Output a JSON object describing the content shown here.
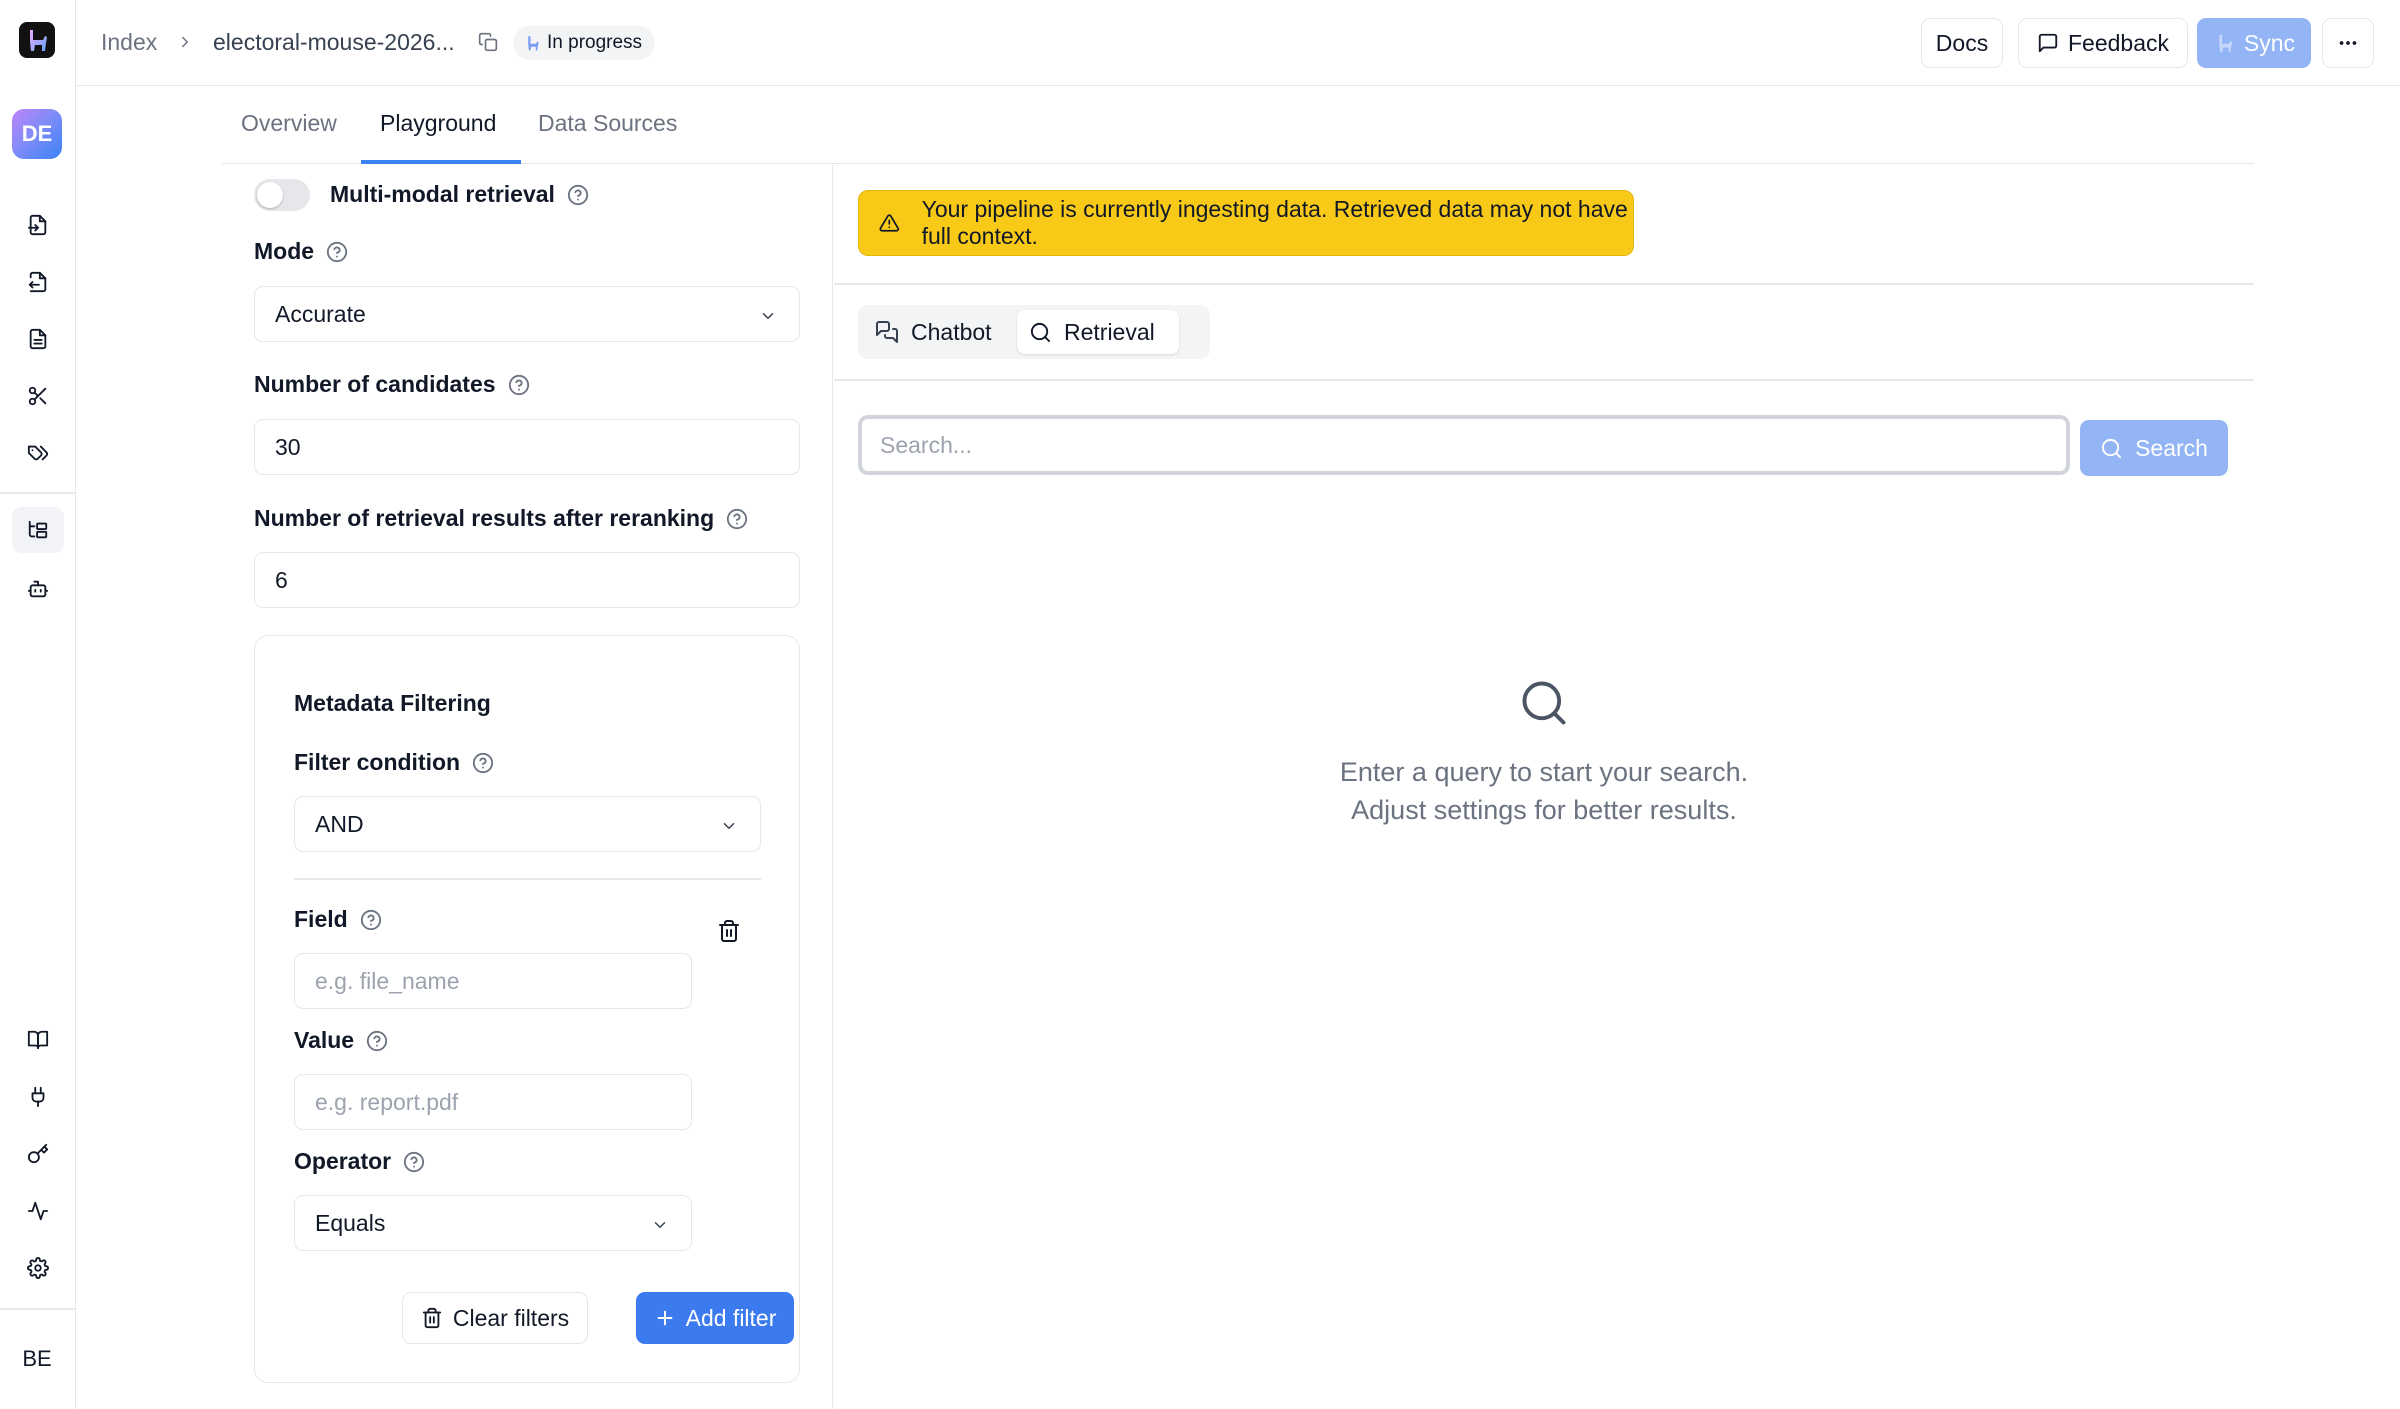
{
  "header": {
    "breadcrumb_root": "Index",
    "breadcrumb_current": "electoral-mouse-2026...",
    "status": "In progress",
    "docs_label": "Docs",
    "feedback_label": "Feedback",
    "sync_label": "Sync"
  },
  "user": {
    "workspace_initials": "DE",
    "account_initials": "BE"
  },
  "tabs": [
    {
      "label": "Overview"
    },
    {
      "label": "Playground"
    },
    {
      "label": "Data Sources"
    }
  ],
  "settings": {
    "multimodal_label": "Multi-modal retrieval",
    "multimodal_enabled": false,
    "mode_label": "Mode",
    "mode_value": "Accurate",
    "candidates_label": "Number of candidates",
    "candidates_value": "30",
    "rerank_label": "Number of retrieval results after reranking",
    "rerank_value": "6"
  },
  "metadata": {
    "title": "Metadata Filtering",
    "condition_label": "Filter condition",
    "condition_value": "AND",
    "field_label": "Field",
    "field_placeholder": "e.g. file_name",
    "value_label": "Value",
    "value_placeholder": "e.g. report.pdf",
    "operator_label": "Operator",
    "operator_value": "Equals",
    "clear_label": "Clear filters",
    "add_label": "Add filter"
  },
  "playground": {
    "warning": "Your pipeline is currently ingesting data. Retrieved data may not have full context.",
    "mode_chatbot": "Chatbot",
    "mode_retrieval": "Retrieval",
    "search_placeholder": "Search...",
    "search_button": "Search",
    "empty_line1": "Enter a query to start your search.",
    "empty_line2": "Adjust settings for better results."
  },
  "colors": {
    "accent": "#3b7bef",
    "warning_bg": "#f8c916",
    "disabled_accent": "#93b4f5"
  }
}
